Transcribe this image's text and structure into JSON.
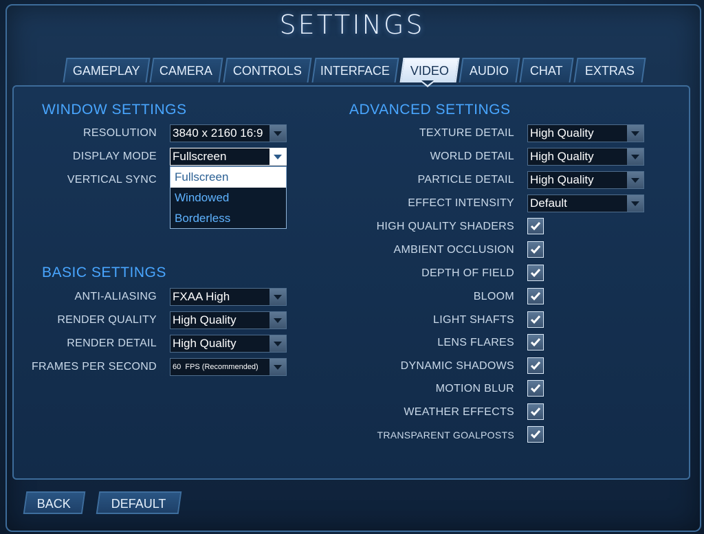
{
  "title": "SETTINGS",
  "tabs": [
    "GAMEPLAY",
    "CAMERA",
    "CONTROLS",
    "INTERFACE",
    "VIDEO",
    "AUDIO",
    "CHAT",
    "EXTRAS"
  ],
  "active_tab": "VIDEO",
  "window_settings": {
    "heading": "WINDOW SETTINGS",
    "resolution_label": "RESOLUTION",
    "resolution_value": "3840 x 2160 16:9",
    "display_mode_label": "DISPLAY MODE",
    "display_mode_value": "Fullscreen",
    "vertical_sync_label": "VERTICAL SYNC",
    "display_mode_options": [
      "Fullscreen",
      "Windowed",
      "Borderless"
    ]
  },
  "basic_settings": {
    "heading": "BASIC SETTINGS",
    "anti_aliasing_label": "ANTI-ALIASING",
    "anti_aliasing_value": "FXAA High",
    "render_quality_label": "RENDER QUALITY",
    "render_quality_value": "High Quality",
    "render_detail_label": "RENDER DETAIL",
    "render_detail_value": "High Quality",
    "fps_label": "FRAMES PER SECOND",
    "fps_value": "60  FPS (Recommended)"
  },
  "advanced_settings": {
    "heading": "ADVANCED SETTINGS",
    "texture_detail_label": "TEXTURE DETAIL",
    "texture_detail_value": "High Quality",
    "world_detail_label": "WORLD DETAIL",
    "world_detail_value": "High Quality",
    "particle_detail_label": "PARTICLE DETAIL",
    "particle_detail_value": "High Quality",
    "effect_intensity_label": "EFFECT INTENSITY",
    "effect_intensity_value": "Default",
    "toggles": [
      {
        "label": "HIGH QUALITY SHADERS",
        "checked": true
      },
      {
        "label": "AMBIENT OCCLUSION",
        "checked": true
      },
      {
        "label": "DEPTH OF FIELD",
        "checked": true
      },
      {
        "label": "BLOOM",
        "checked": true
      },
      {
        "label": "LIGHT SHAFTS",
        "checked": true
      },
      {
        "label": "LENS FLARES",
        "checked": true
      },
      {
        "label": "DYNAMIC SHADOWS",
        "checked": true
      },
      {
        "label": "MOTION BLUR",
        "checked": true
      },
      {
        "label": "WEATHER EFFECTS",
        "checked": true
      },
      {
        "label": "TRANSPARENT GOALPOSTS",
        "checked": true
      }
    ]
  },
  "footer": {
    "back_label": "BACK",
    "default_label": "DEFAULT"
  },
  "colors": {
    "accent": "#49a6ff",
    "panel": "#173456",
    "border": "#3d6c9a"
  }
}
